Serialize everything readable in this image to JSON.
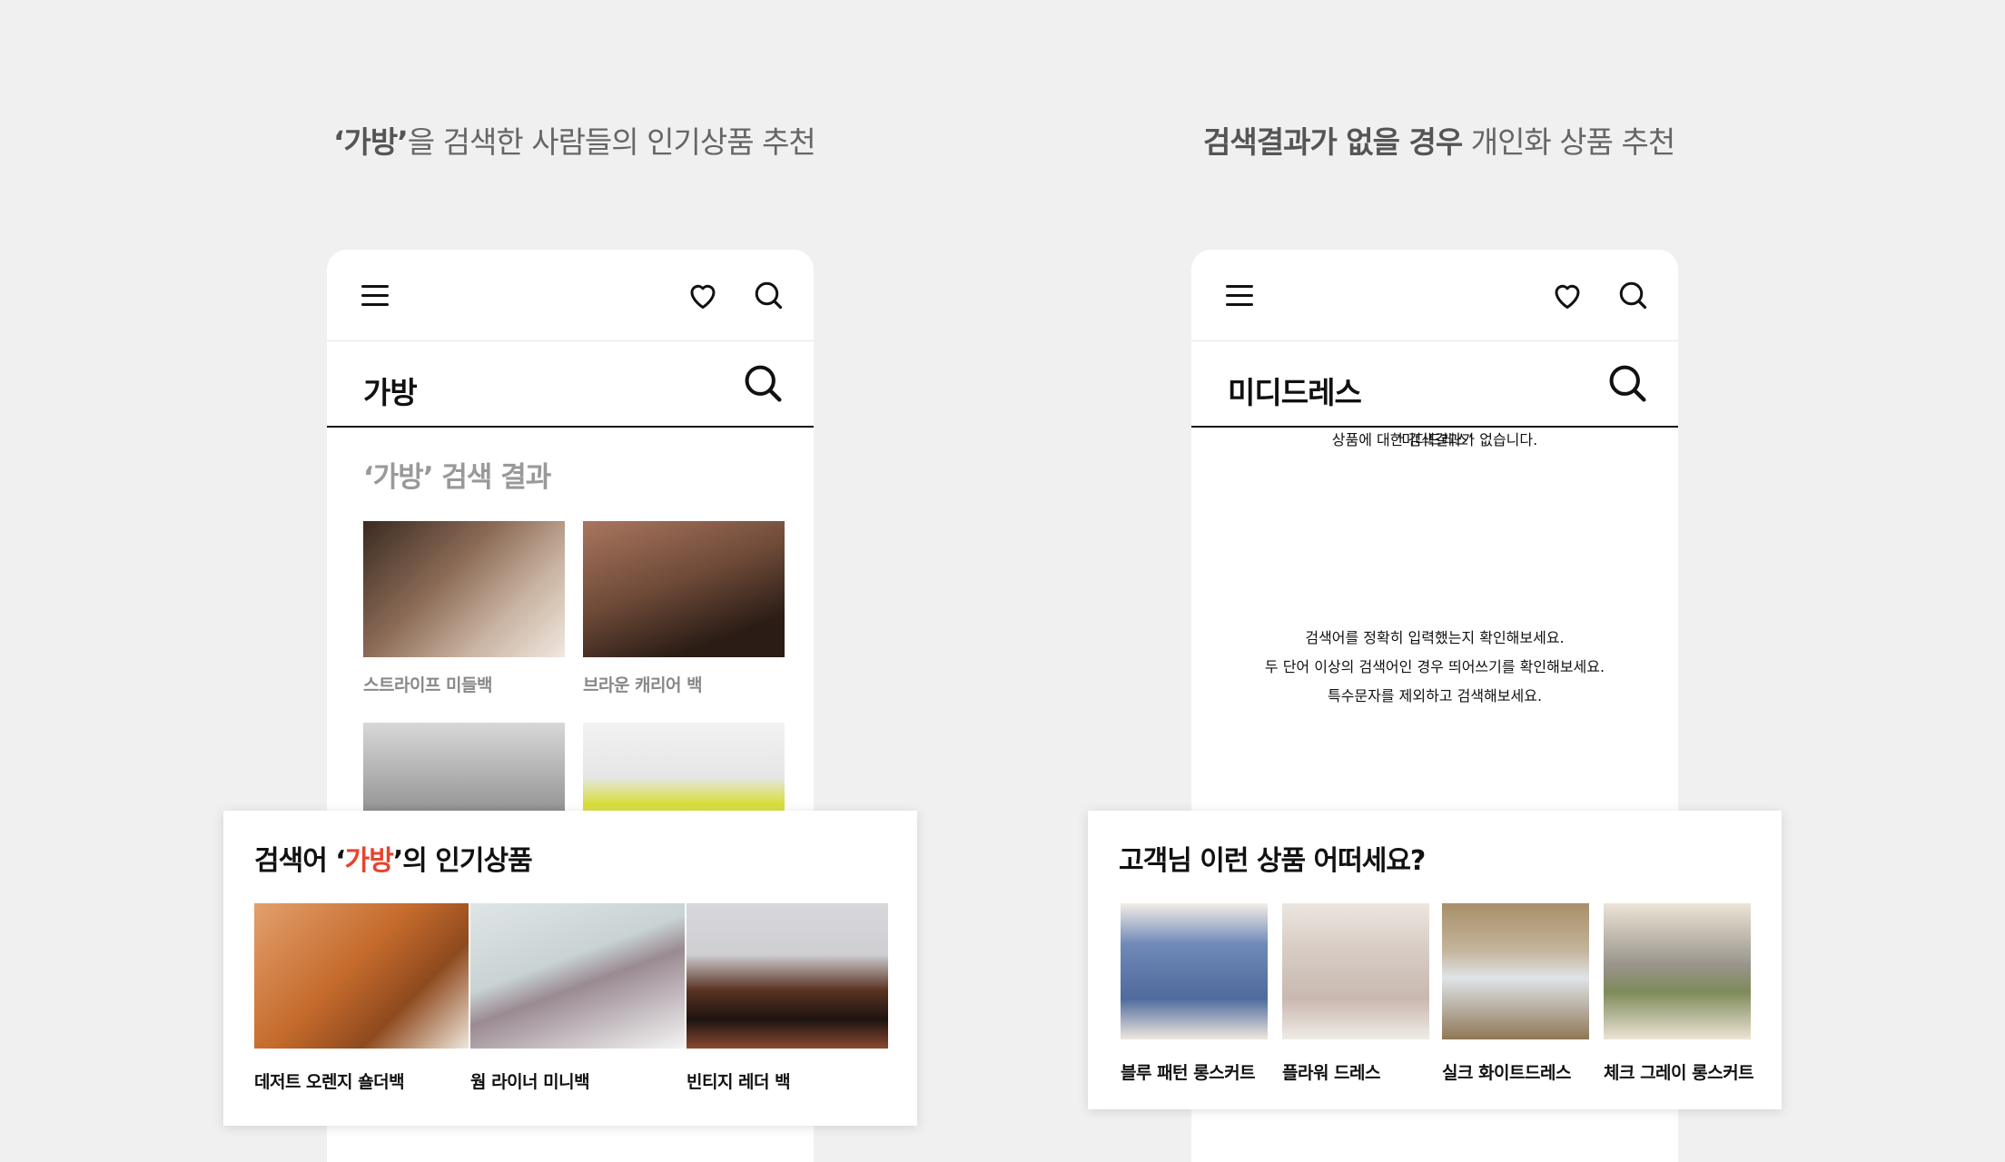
{
  "left": {
    "caption_bold": "‘가방’",
    "caption_rest": "을 검색한 사람들의 인기상품 추천",
    "search_query": "가방",
    "results_title": "‘가방’ 검색 결과",
    "results": [
      {
        "label": "스트라이프 미들백",
        "color": "#8a6a55"
      },
      {
        "label": "브라운 캐리어 백",
        "color": "#6e4a38"
      },
      {
        "label": "",
        "color": "#cfcfcf"
      },
      {
        "label": "",
        "color": "#e6e6e6"
      }
    ],
    "card": {
      "title_prefix": "검색어 ‘",
      "title_accent": "가방",
      "title_suffix": "’의 인기상품",
      "products": [
        {
          "label": "데저트 오렌지 숄더백",
          "color": "#c46a2c"
        },
        {
          "label": "웜 라이너 미니백",
          "color": "#c9d3d4"
        },
        {
          "label": "빈티지 레더 백",
          "color": "#5a3222"
        }
      ]
    }
  },
  "right": {
    "caption_bold": "검색결과가 없을 경우",
    "caption_rest": " 개인화 상품 추천",
    "search_query": "미디드레스",
    "empty_query": "‘미디드레스’",
    "empty_message": "상품에 대한 검색결과가 없습니다.",
    "tips": [
      "검색어를 정확히 입력했는지 확인해보세요.",
      "두 단어 이상의 검색어인 경우 띄어쓰기를 확인해보세요.",
      "특수문자를 제외하고 검색해보세요."
    ],
    "card": {
      "title": "고객님 이런 상품 어떠세요?",
      "products": [
        {
          "label": "블루 패턴 롱스커트",
          "color": "#6f89b8"
        },
        {
          "label": "플라워 드레스",
          "color": "#d9cfc7"
        },
        {
          "label": "실크 화이트드레스",
          "color": "#a88f6a"
        },
        {
          "label": "체크 그레이 롱스커트",
          "color": "#ece4d6"
        }
      ]
    }
  },
  "colors": {
    "accent": "#e8432e",
    "background": "#f0f0f0"
  }
}
